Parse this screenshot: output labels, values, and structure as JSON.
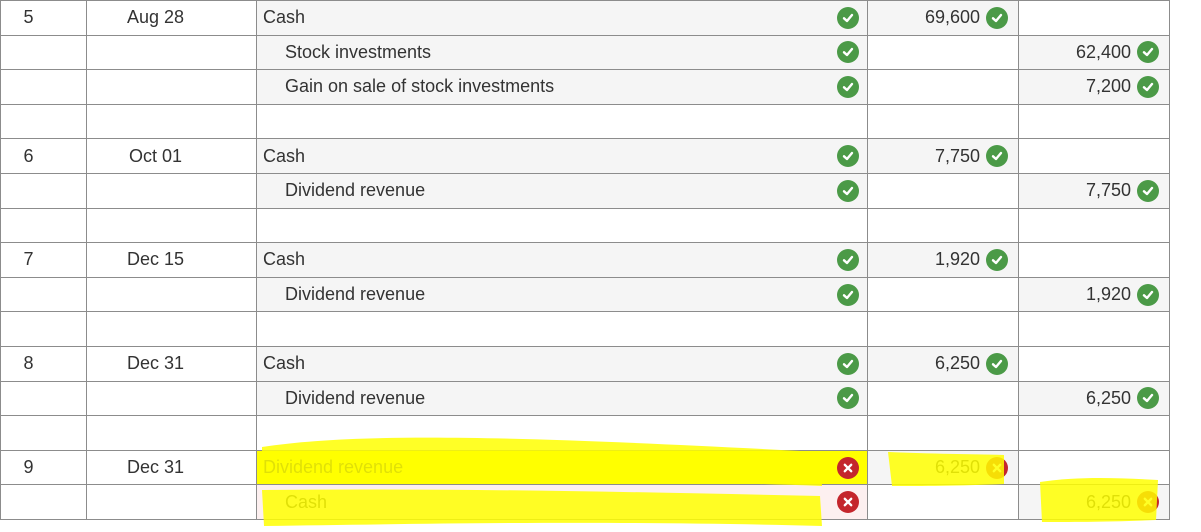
{
  "entries": [
    {
      "no": "5",
      "date": "Aug 28",
      "lines": [
        {
          "account": "Cash",
          "indent": false,
          "account_status": "correct",
          "debit": "69,600",
          "debit_status": "correct",
          "credit": "",
          "credit_status": ""
        },
        {
          "account": "Stock investments",
          "indent": true,
          "account_status": "correct",
          "debit": "",
          "debit_status": "",
          "credit": "62,400",
          "credit_status": "correct"
        },
        {
          "account": "Gain on sale of stock investments",
          "indent": true,
          "account_status": "correct",
          "debit": "",
          "debit_status": "",
          "credit": "7,200",
          "credit_status": "correct"
        }
      ]
    },
    {
      "no": "6",
      "date": "Oct 01",
      "lines": [
        {
          "account": "Cash",
          "indent": false,
          "account_status": "correct",
          "debit": "7,750",
          "debit_status": "correct",
          "credit": "",
          "credit_status": ""
        },
        {
          "account": "Dividend revenue",
          "indent": true,
          "account_status": "correct",
          "debit": "",
          "debit_status": "",
          "credit": "7,750",
          "credit_status": "correct"
        }
      ]
    },
    {
      "no": "7",
      "date": "Dec 15",
      "lines": [
        {
          "account": "Cash",
          "indent": false,
          "account_status": "correct",
          "debit": "1,920",
          "debit_status": "correct",
          "credit": "",
          "credit_status": ""
        },
        {
          "account": "Dividend revenue",
          "indent": true,
          "account_status": "correct",
          "debit": "",
          "debit_status": "",
          "credit": "1,920",
          "credit_status": "correct"
        }
      ]
    },
    {
      "no": "8",
      "date": "Dec 31",
      "lines": [
        {
          "account": "Cash",
          "indent": false,
          "account_status": "correct",
          "debit": "6,250",
          "debit_status": "correct",
          "credit": "",
          "credit_status": ""
        },
        {
          "account": "Dividend revenue",
          "indent": true,
          "account_status": "correct",
          "debit": "",
          "debit_status": "",
          "credit": "6,250",
          "credit_status": "correct"
        }
      ]
    },
    {
      "no": "9",
      "date": "Dec 31",
      "highlighted": true,
      "lines": [
        {
          "account": "Dividend revenue",
          "indent": false,
          "account_status": "incorrect",
          "debit": "6,250",
          "debit_status": "incorrect",
          "credit": "",
          "credit_status": ""
        },
        {
          "account": "Cash",
          "indent": true,
          "account_status": "incorrect",
          "debit": "",
          "debit_status": "",
          "credit": "6,250",
          "credit_status": "incorrect"
        }
      ]
    }
  ],
  "colors": {
    "correct": "#4b9a47",
    "incorrect": "#c4262c",
    "highlight": "#ffff00",
    "border": "#8c8c8c",
    "cell_bg": "#f5f5f5"
  },
  "icons": {
    "correct": "check-circle-icon",
    "incorrect": "x-circle-icon"
  }
}
